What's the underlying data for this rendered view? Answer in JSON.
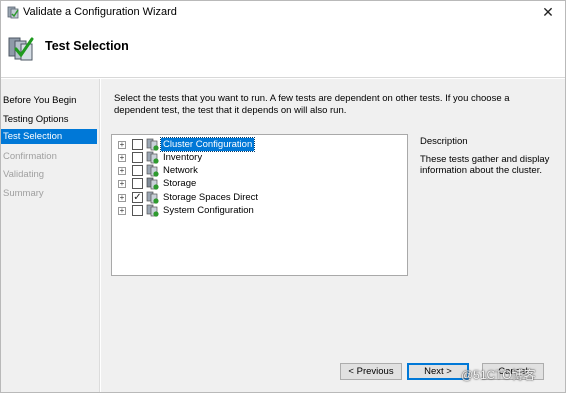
{
  "window": {
    "title": "Validate a Configuration Wizard",
    "close_glyph": "✕",
    "icon": "cluster-wizard-icon"
  },
  "header": {
    "title": "Test Selection",
    "icon": "cluster-checkmark-icon"
  },
  "nav": {
    "items": [
      {
        "label": "Before You Begin",
        "state": "normal"
      },
      {
        "label": "Testing Options",
        "state": "normal"
      },
      {
        "label": "Test Selection",
        "state": "active"
      },
      {
        "label": "Confirmation",
        "state": "disabled"
      },
      {
        "label": "Validating",
        "state": "disabled"
      },
      {
        "label": "Summary",
        "state": "disabled"
      }
    ]
  },
  "main": {
    "intro_line1": "Select the tests that you want to run.  A few tests are dependent on other tests.  If you choose a",
    "intro_line2": "dependent test, the test that it depends on will also run.",
    "tree": [
      {
        "label": "Cluster Configuration",
        "checked": false,
        "selected": true,
        "icon": "cluster-config-icon"
      },
      {
        "label": "Inventory",
        "checked": false,
        "selected": false,
        "icon": "inventory-icon"
      },
      {
        "label": "Network",
        "checked": false,
        "selected": false,
        "icon": "network-icon"
      },
      {
        "label": "Storage",
        "checked": false,
        "selected": false,
        "icon": "storage-icon"
      },
      {
        "label": "Storage Spaces Direct",
        "checked": true,
        "selected": false,
        "icon": "storage-spaces-icon"
      },
      {
        "label": "System Configuration",
        "checked": false,
        "selected": false,
        "icon": "system-config-icon"
      }
    ],
    "expander_glyph": "+",
    "check_glyph": "✓",
    "description_heading": "Description",
    "description_text": "These tests gather and display information about the cluster."
  },
  "footer": {
    "previous_label": "< Previous",
    "next_label": "Next >",
    "cancel_label": "Cancel"
  },
  "watermark": "@51CTO博客",
  "colors": {
    "accent": "#0078d7",
    "panel": "#f0f0f0",
    "disabled_text": "#a0a0a0"
  }
}
